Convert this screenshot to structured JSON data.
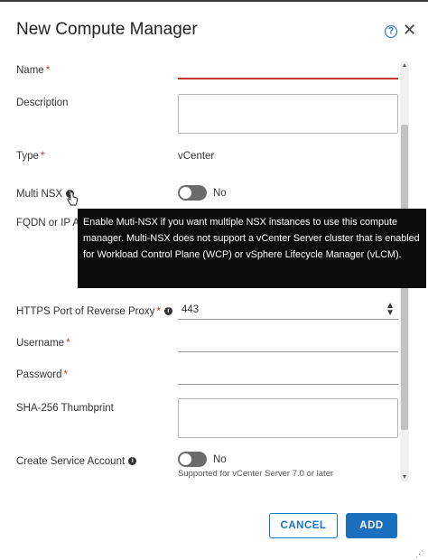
{
  "dialog": {
    "title": "New Compute Manager",
    "help_icon": "?",
    "close_icon": "✕"
  },
  "form": {
    "name_label": "Name",
    "description_label": "Description",
    "type_label": "Type",
    "type_value": "vCenter",
    "multi_nsx_label": "Multi NSX",
    "multi_nsx_value": "No",
    "fqdn_label": "FQDN or IP A",
    "https_port_label": "HTTPS Port of Reverse Proxy",
    "https_port_value": "443",
    "username_label": "Username",
    "password_label": "Password",
    "thumbprint_label": "SHA-256 Thumbprint",
    "service_account_label": "Create Service Account",
    "service_account_value": "No",
    "service_account_helper": "Supported for vCenter Server 7.0 or later",
    "required_marker": "*"
  },
  "tooltip": {
    "text": "Enable Muti-NSX if you want multiple NSX instances to use this compute manager. Multi-NSX does not support a vCenter Server cluster that is enabled for Workload Control Plane (WCP) or vSphere Lifecycle Manager (vLCM)."
  },
  "buttons": {
    "cancel_label": "CANCEL",
    "add_label": "ADD"
  },
  "colors": {
    "accent": "#1a73c8",
    "primary_button": "#1a6fbf",
    "error": "#c0392b",
    "tooltip_bg": "#0d0d0d"
  }
}
